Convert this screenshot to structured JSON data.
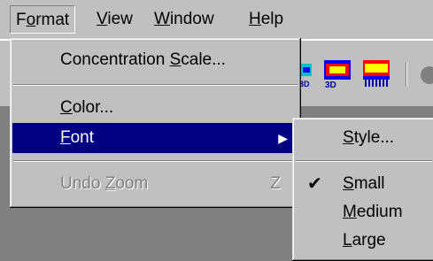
{
  "menubar": {
    "items": [
      {
        "label_pre": "F",
        "label_ul": "o",
        "label_post": "rmat"
      },
      {
        "label_pre": "",
        "label_ul": "V",
        "label_post": "iew"
      },
      {
        "label_pre": "",
        "label_ul": "W",
        "label_post": "indow"
      },
      {
        "label_pre": "",
        "label_ul": "H",
        "label_post": "elp"
      }
    ]
  },
  "toolbar": {
    "icons": [
      "concentration-3d-icon",
      "color-3d-icon",
      "shaded-map-icon",
      "circle-icon"
    ],
    "icon_labels": [
      "3D",
      "3D"
    ]
  },
  "format_menu": {
    "items": [
      {
        "pre": "Concentration ",
        "ul": "S",
        "post": "cale..."
      },
      {
        "pre": "",
        "ul": "C",
        "post": "olor..."
      },
      {
        "pre": "",
        "ul": "F",
        "post": "ont",
        "arrow": "▶"
      },
      {
        "pre": "Undo ",
        "ul": "Z",
        "post": "oom",
        "shortcut": "Z"
      }
    ]
  },
  "font_submenu": {
    "items": [
      {
        "pre": "",
        "ul": "S",
        "post": "tyle..."
      },
      {
        "pre": "",
        "ul": "S",
        "post": "mall",
        "check": "✔"
      },
      {
        "pre": "",
        "ul": "M",
        "post": "edium"
      },
      {
        "pre": "",
        "ul": "L",
        "post": "arge"
      }
    ]
  },
  "colors": {
    "menu_bg": "#c0c0c0",
    "highlight": "#000080",
    "disabled": "#808080",
    "client": "#808080"
  }
}
